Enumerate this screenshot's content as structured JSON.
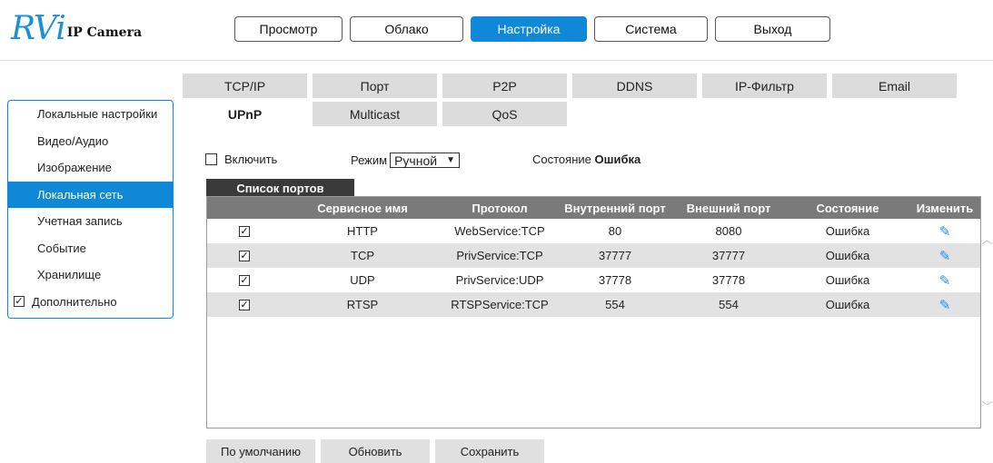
{
  "logo": {
    "mark": "RVi",
    "text": "IP Camera"
  },
  "topnav": [
    "Просмотр",
    "Облако",
    "Настройка",
    "Система",
    "Выход"
  ],
  "sidebar": [
    "Локальные настройки",
    "Видео/Аудио",
    "Изображение",
    "Локальная сеть",
    "Учетная запись",
    "Событие",
    "Хранилище",
    "Дополнительно"
  ],
  "tabs": [
    "TCP/IP",
    "Порт",
    "P2P",
    "DDNS",
    "IP-Фильтр",
    "Email",
    "UPnP",
    "Multicast",
    "QoS"
  ],
  "controls": {
    "enable_label": "Включить",
    "mode_label": "Режим",
    "mode_value": "Ручной",
    "state_label": "Состояние",
    "state_value": "Ошибка"
  },
  "ports": {
    "title": "Список портов",
    "headers": [
      "Сервисное имя",
      "Протокол",
      "Внутренний порт",
      "Внешний порт",
      "Состояние",
      "Изменить"
    ],
    "rows": [
      {
        "name": "HTTP",
        "protocol": "WebService:TCP",
        "internal": "80",
        "external": "8080",
        "state": "Ошибка"
      },
      {
        "name": "TCP",
        "protocol": "PrivService:TCP",
        "internal": "37777",
        "external": "37777",
        "state": "Ошибка"
      },
      {
        "name": "UDP",
        "protocol": "PrivService:UDP",
        "internal": "37778",
        "external": "37778",
        "state": "Ошибка"
      },
      {
        "name": "RTSP",
        "protocol": "RTSPService:TCP",
        "internal": "554",
        "external": "554",
        "state": "Ошибка"
      }
    ]
  },
  "buttons": [
    "По умолчанию",
    "Обновить",
    "Сохранить"
  ],
  "icons": {
    "checkmark": "✓",
    "edit": "pencil-icon",
    "chevron": "chevron-down-icon"
  },
  "colors": {
    "accent": "#1088d8",
    "header_row": "#7a7a7a",
    "tab": "#dcdcdc"
  }
}
